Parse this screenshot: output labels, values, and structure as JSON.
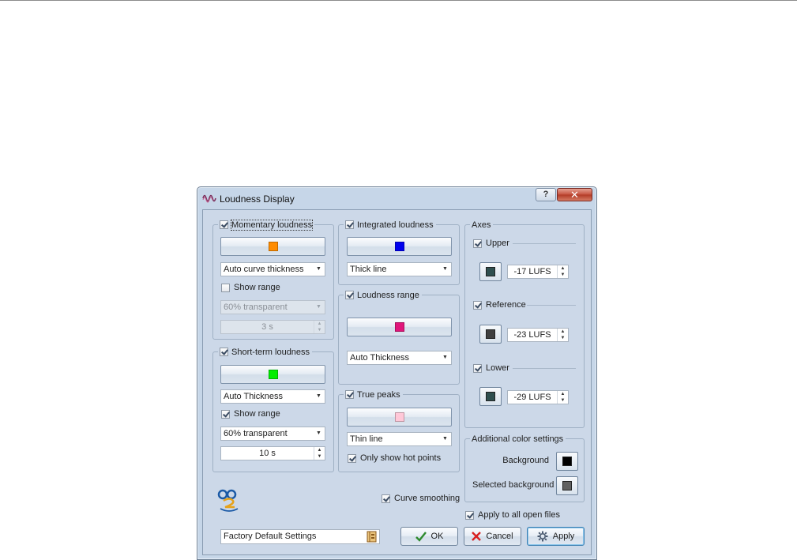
{
  "window": {
    "title": "Loudness Display",
    "help_label": "?",
    "close_label": "✕"
  },
  "momentary": {
    "label": "Momentary loudness",
    "checked": true,
    "color": "#ff8c00",
    "thickness": "Auto curve thickness",
    "show_range_label": "Show range",
    "show_range_checked": false,
    "transparency": "60% transparent",
    "duration": "3 s"
  },
  "shortterm": {
    "label": "Short-term loudness",
    "checked": true,
    "color": "#00ee00",
    "thickness": "Auto Thickness",
    "show_range_label": "Show range",
    "show_range_checked": true,
    "transparency": "60% transparent",
    "duration": "10 s"
  },
  "integrated": {
    "label": "Integrated loudness",
    "checked": true,
    "color": "#0000ee",
    "thickness": "Thick line"
  },
  "range": {
    "label": "Loudness range",
    "checked": true,
    "color": "#e0157a",
    "thickness": "Auto Thickness"
  },
  "truepeaks": {
    "label": "True peaks",
    "checked": true,
    "color": "#ffc8d8",
    "thickness": "Thin line",
    "hot_label": "Only show hot points",
    "hot_checked": true
  },
  "axes": {
    "label": "Axes",
    "upper": {
      "label": "Upper",
      "checked": true,
      "color": "#2f4f4f",
      "value": "-17 LUFS"
    },
    "reference": {
      "label": "Reference",
      "checked": true,
      "color": "#404040",
      "value": "-23 LUFS"
    },
    "lower": {
      "label": "Lower",
      "checked": true,
      "color": "#2f4f4f",
      "value": "-29 LUFS"
    }
  },
  "additional": {
    "label": "Additional color settings",
    "background_label": "Background",
    "background_color": "#000000",
    "selected_label": "Selected background",
    "selected_color": "#606060"
  },
  "curve_smoothing": {
    "label": "Curve smoothing",
    "checked": true
  },
  "apply_all": {
    "label": "Apply to all open files",
    "checked": true
  },
  "preset": "Factory Default Settings",
  "buttons": {
    "ok": "OK",
    "cancel": "Cancel",
    "apply": "Apply"
  },
  "icons": {
    "app": "waveform-icon",
    "preset": "preset-book-icon",
    "ok": "checkmark-icon",
    "cancel": "red-x-icon",
    "apply": "gear-icon",
    "logo": "app-logo-icon"
  }
}
